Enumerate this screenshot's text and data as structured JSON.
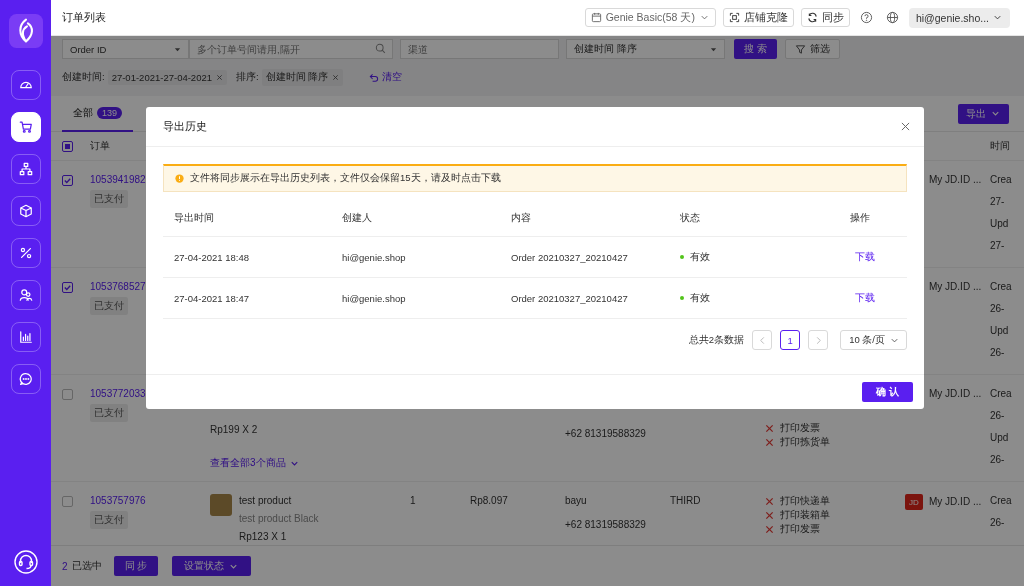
{
  "sidebar": {
    "nav": [
      {
        "kind": "gauge",
        "selected": false
      },
      {
        "kind": "cart",
        "selected": true
      },
      {
        "kind": "hierarchy",
        "selected": false
      },
      {
        "kind": "cube",
        "selected": false
      },
      {
        "kind": "percent",
        "selected": false
      },
      {
        "kind": "users",
        "selected": false
      },
      {
        "kind": "chart",
        "selected": false
      },
      {
        "kind": "chat",
        "selected": false
      }
    ]
  },
  "header": {
    "title": "订单列表",
    "plan": "Genie Basic(58 天)",
    "clone_button": "店铺克隆",
    "sync_button": "同步",
    "account": "hi@genie.sho..."
  },
  "filters": {
    "id_type": "Order ID",
    "id_placeholder": "多个订单号间请用,隔开",
    "channel_placeholder": "渠道",
    "sort": "创建时间 降序",
    "search_button": "搜 索",
    "filter_button": "筛选",
    "chips": [
      {
        "label": "创建时间:",
        "value": "27-01-2021-27-04-2021"
      },
      {
        "label": "排序:",
        "value": "创建时间 降序"
      }
    ],
    "clear": "清空"
  },
  "tabs": [
    {
      "label": "全部",
      "count": "139",
      "selected": true
    }
  ],
  "export_button": "导出",
  "table": {
    "select_all_indeterminate": true,
    "order_header": "订单",
    "time_header": "时间"
  },
  "rows": [
    {
      "checked": true,
      "order_id": "1053941982",
      "status": "已支付",
      "store": {
        "name": "My JD.ID ..."
      },
      "time_lines": [
        "Crea",
        "27-",
        "Upd",
        "27-"
      ]
    },
    {
      "checked": true,
      "order_id": "1053768527",
      "status": "已支付",
      "store": {
        "name": "My JD.ID ..."
      },
      "time_lines": [
        "Crea",
        "26-",
        "Upd",
        "26-"
      ]
    },
    {
      "checked": false,
      "order_id": "1053772033",
      "status": "已支付",
      "product": {
        "price_qty": "Rp199 X 2",
        "more_link": "查看全部3个商品"
      },
      "buyer": {
        "phone": "+62 81319588329"
      },
      "print_tasks": [
        {
          "label": "打印发票",
          "done": false
        },
        {
          "label": "打印拣货单",
          "done": false
        }
      ],
      "store": {
        "name": "My JD.ID ..."
      },
      "time_lines": [
        "Crea",
        "26-",
        "Upd",
        "26-"
      ]
    },
    {
      "checked": false,
      "order_id": "1053757976",
      "status": "已支付",
      "product": {
        "name": "test product",
        "variant": "test product Black",
        "price_qty": "Rp123 X 1"
      },
      "quantity": "1",
      "amount": "Rp8.097",
      "buyer": {
        "name": "bayu",
        "phone": "+62 81319588329"
      },
      "shipping": "THIRD",
      "print_tasks": [
        {
          "label": "打印快递单",
          "done": false
        },
        {
          "label": "打印装箱单",
          "done": false
        },
        {
          "label": "打印发票",
          "done": false
        }
      ],
      "store": {
        "logo": "JD",
        "name": "My JD.ID ..."
      },
      "time_lines": [
        "Crea",
        "26-"
      ]
    }
  ],
  "footer": {
    "selected_count": "2",
    "selected_label": "已选中",
    "sync_button": "同 步",
    "status_button": "设置状态"
  },
  "dialog": {
    "title": "导出历史",
    "notice": "文件将同步展示在导出历史列表，文件仅会保留15天，请及时点击下载",
    "columns": [
      "导出时间",
      "创建人",
      "内容",
      "状态",
      "操作"
    ],
    "rows": [
      {
        "time": "27-04-2021 18:48",
        "creator": "hi@genie.shop",
        "content": "Order 20210327_20210427",
        "status": "有效",
        "color": "#52c41a",
        "action": "下载"
      },
      {
        "time": "27-04-2021 18:47",
        "creator": "hi@genie.shop",
        "content": "Order 20210327_20210427",
        "status": "有效",
        "color": "#52c41a",
        "action": "下载"
      }
    ],
    "pagination": {
      "total": "总共2条数据",
      "prev_disabled": true,
      "next_disabled": true,
      "pages": [
        {
          "label": "1",
          "selected": true
        }
      ],
      "page_size": "10 条/页"
    },
    "confirm_button": "确 认"
  }
}
